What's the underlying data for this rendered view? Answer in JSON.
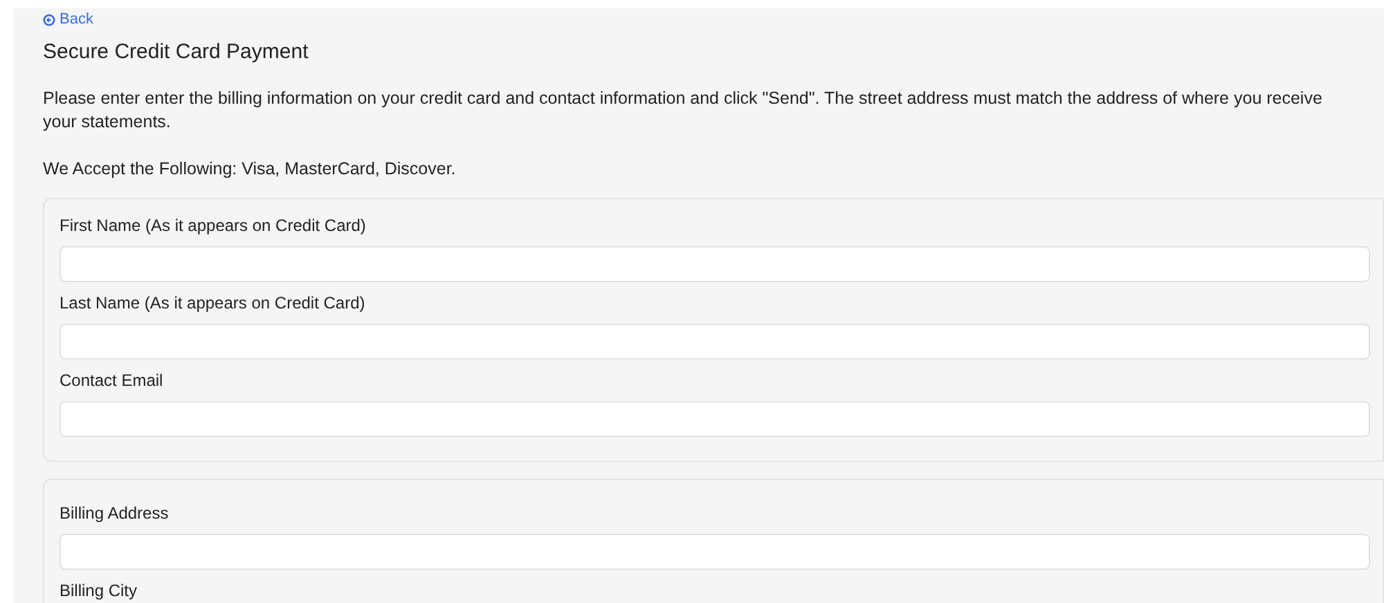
{
  "back_link": "Back",
  "title": "Secure Credit Card Payment",
  "intro": [
    "Please enter enter the billing information on your credit card and contact information and click \"Send\". The street address must match the address of where you receive your statements.",
    "We Accept the Following: Visa, MasterCard, Discover."
  ],
  "sections": [
    {
      "fields": [
        {
          "label": "First Name (As it appears on Credit Card)"
        },
        {
          "label": "Last Name (As it appears on Credit Card)"
        },
        {
          "label": "Contact Email"
        }
      ]
    },
    {
      "fields": [
        {
          "label": "Billing Address"
        },
        {
          "label": "Billing City"
        }
      ]
    }
  ]
}
